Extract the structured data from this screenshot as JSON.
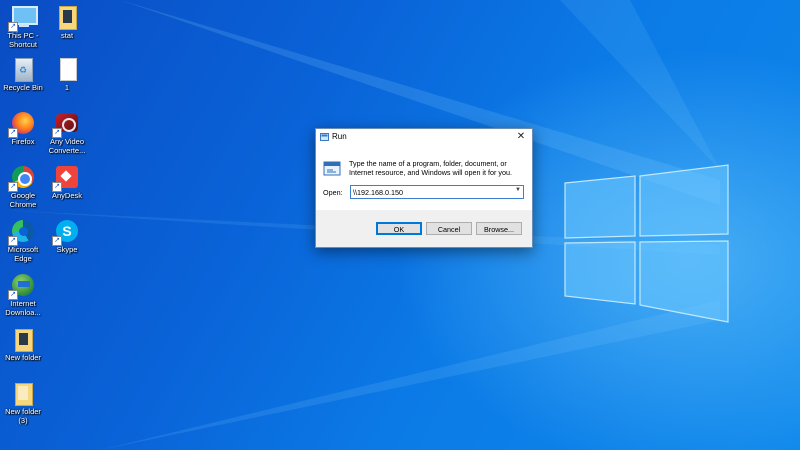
{
  "desktop": {
    "icons": [
      {
        "label": "This PC - Shortcut",
        "name": "this-pc-icon"
      },
      {
        "label": "stat",
        "name": "folder-icon"
      },
      {
        "label": "Recycle Bin",
        "name": "recycle-bin-icon"
      },
      {
        "label": "1",
        "name": "file-icon"
      },
      {
        "label": "Firefox",
        "name": "firefox-icon"
      },
      {
        "label": "Any Video Converte...",
        "name": "video-converter-icon"
      },
      {
        "label": "Google Chrome",
        "name": "chrome-icon"
      },
      {
        "label": "AnyDesk",
        "name": "anydesk-icon"
      },
      {
        "label": "Microsoft Edge",
        "name": "edge-icon"
      },
      {
        "label": "Skype",
        "name": "skype-icon"
      },
      {
        "label": "Internet Downloa...",
        "name": "internet-download-manager-icon"
      },
      {
        "label": "New folder",
        "name": "folder-icon"
      },
      {
        "label": "New folder (3)",
        "name": "folder-icon"
      }
    ]
  },
  "run": {
    "title": "Run",
    "description": "Type the name of a program, folder, document, or Internet resource, and Windows will open it for you.",
    "open_label": "Open:",
    "open_value": "\\\\192.168.0.150",
    "ok": "OK",
    "cancel": "Cancel",
    "browse": "Browse..."
  }
}
